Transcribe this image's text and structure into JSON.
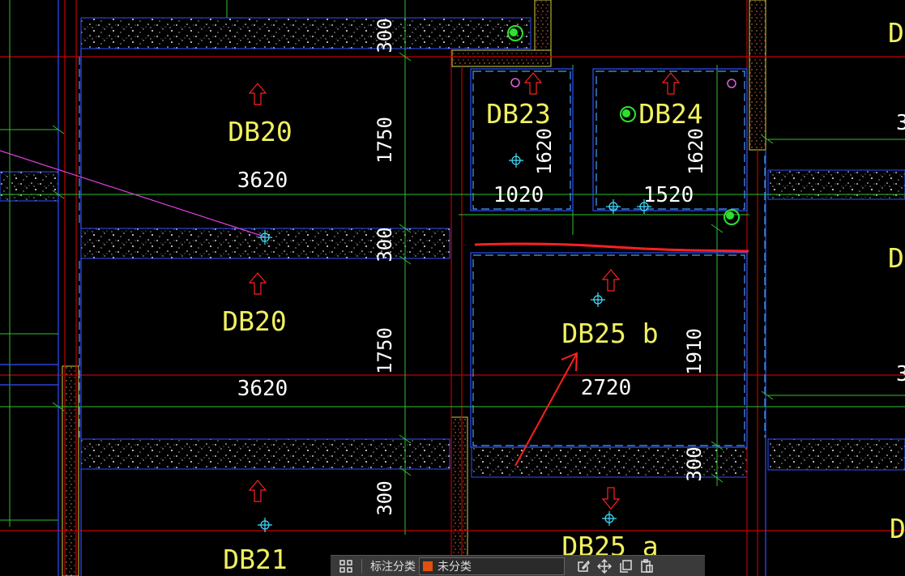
{
  "drawing": {
    "slab_labels": [
      {
        "id": "db20-top",
        "text": "DB20"
      },
      {
        "id": "db20-mid",
        "text": "DB20"
      },
      {
        "id": "db21",
        "text": "DB21"
      },
      {
        "id": "db23",
        "text": "DB23"
      },
      {
        "id": "db24",
        "text": "DB24"
      },
      {
        "id": "db25b",
        "text": "DB25 b"
      },
      {
        "id": "db25a",
        "text": "DB25 a"
      }
    ],
    "dimensions": [
      {
        "id": "d1",
        "text": "3620"
      },
      {
        "id": "d2",
        "text": "3620"
      },
      {
        "id": "d3",
        "text": "1020"
      },
      {
        "id": "d4",
        "text": "1520"
      },
      {
        "id": "d5",
        "text": "2720"
      },
      {
        "id": "v1",
        "text": "300"
      },
      {
        "id": "v2",
        "text": "1750"
      },
      {
        "id": "v3",
        "text": "300"
      },
      {
        "id": "v4",
        "text": "1750"
      },
      {
        "id": "v5",
        "text": "300"
      },
      {
        "id": "v6",
        "text": "1620"
      },
      {
        "id": "v7",
        "text": "1620"
      },
      {
        "id": "v8",
        "text": "1910"
      },
      {
        "id": "v9",
        "text": "300"
      }
    ],
    "edge_fragments": [
      {
        "id": "e1",
        "text": "D"
      },
      {
        "id": "e2",
        "text": "3"
      },
      {
        "id": "e3",
        "text": "D"
      },
      {
        "id": "e4",
        "text": "3"
      },
      {
        "id": "e5",
        "text": "D"
      }
    ],
    "colors": {
      "background": "#000000",
      "slab_text": "#f0f060",
      "dim_text": "#ffffff",
      "axis_red": "#c00000",
      "grid_green": "#30c030",
      "beam_blue": "#3050ff",
      "dashed_cyan": "#40a0ff",
      "wall_yellow": "#d0d040",
      "arrow_red": "#ff2020",
      "leader_magenta": "#e040e0",
      "marker_cyan": "#40e0ff"
    }
  },
  "toolbar": {
    "grid_icon": "grid-icon",
    "category_label": "标注分类",
    "category_value": "未分类",
    "category_swatch": "#e05010",
    "tools": [
      "edit-icon",
      "move-icon",
      "copy-icon",
      "paste-icon"
    ]
  }
}
